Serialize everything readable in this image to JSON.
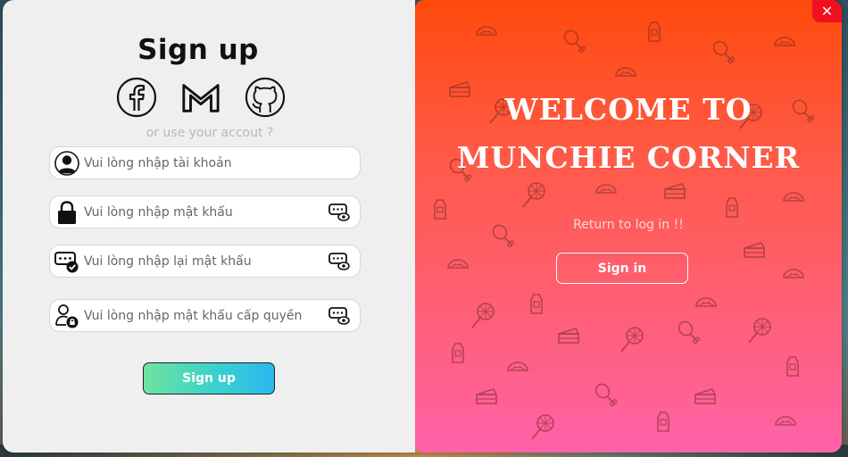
{
  "signup": {
    "title": "Sign up",
    "alt_text": "or use your accout ?",
    "socials": [
      "facebook",
      "gmail",
      "github"
    ],
    "fields": {
      "account_placeholder": "Vui lòng nhập tài khoản",
      "password_placeholder": "Vui lòng nhập mật khẩu",
      "confirm_placeholder": "Vui lòng nhập lại mật khẩu",
      "admin_placeholder": "Vui lòng nhập mật khẩu cấp quyền"
    },
    "button_label": "Sign up"
  },
  "welcome": {
    "line1": "WELCOME TO",
    "line2": "MUNCHIE CORNER",
    "return_text": "Return to log in !!",
    "signin_label": "Sign in"
  },
  "window": {
    "close_label": "✕"
  },
  "colors": {
    "accent_gradient_start": "#ff4a0c",
    "accent_gradient_end": "#ff62a8",
    "button_gradient_start": "#6fe3a0",
    "button_gradient_end": "#2ab8f0",
    "close_button": "#f01020"
  },
  "icons": {
    "account": "user-icon",
    "password": "lock-icon",
    "confirm": "password-check-icon",
    "admin": "user-lock-icon",
    "toggle": "show-password-icon"
  }
}
